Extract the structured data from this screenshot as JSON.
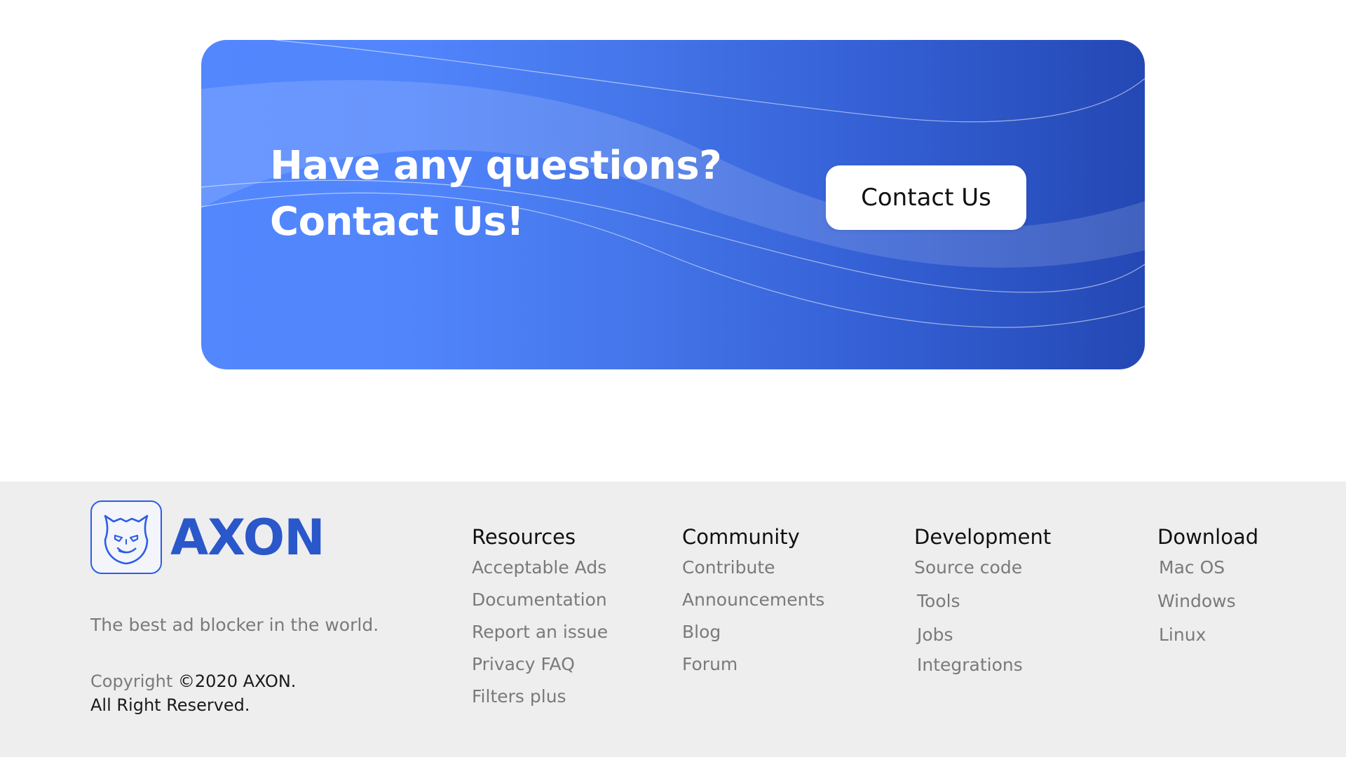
{
  "cta": {
    "title_line1": "Have any questions?",
    "title_line2": "Contact Us!",
    "button_label": "Contact Us",
    "gradient_colors": [
      "#5387fe",
      "#2448b4"
    ]
  },
  "footer": {
    "brand": {
      "name": "AXON",
      "logo_icon": "axon-mask-logo-icon",
      "tagline": "The best ad blocker in the world.",
      "copyright_prefix": "Copyright ",
      "copyright_main": "©2020 AXON.",
      "copyright_line2": "All Right Reserved."
    },
    "columns": [
      {
        "heading": "Resources",
        "links": [
          "Acceptable Ads",
          "Documentation",
          "Report an issue",
          "Privacy FAQ",
          "Filters plus"
        ]
      },
      {
        "heading": "Community",
        "links": [
          "Contribute",
          "Announcements",
          "Blog",
          "Forum"
        ]
      },
      {
        "heading": "Development",
        "links": [
          "Source code",
          "Tools",
          "Jobs",
          "Integrations"
        ]
      },
      {
        "heading": "Download",
        "links": [
          "Mac OS",
          "Windows",
          "Linux"
        ]
      }
    ],
    "colors": {
      "background": "#eeeeef",
      "brand": "#2a57c9",
      "muted_text": "#7a7a7a"
    }
  }
}
